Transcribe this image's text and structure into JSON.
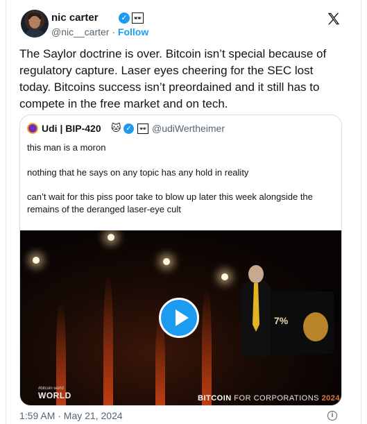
{
  "author": {
    "name": "nic carter",
    "handle": "@nic__carter",
    "separator": "·",
    "follow_label": "Follow",
    "verified_glyph": "✓",
    "affiliate_icon": "badge-icon"
  },
  "tweet": {
    "text": "The Saylor doctrine is over. Bitcoin isn’t special because of regulatory capture. Laser eyes cheering for the SEC lost today. Bitcoins success isn’t preordained and it still has to compete in the free market and on tech."
  },
  "quote": {
    "name": "Udi | BIP-420",
    "cat_emoji": "🐱",
    "verified_glyph": "✓",
    "handle": "@udiWertheimer",
    "lines": [
      "this man is a moron",
      "nothing that he says on any topic has any hold in reality",
      "can’t wait for this piss poor take to blow up later this week alongside the remains of the deranged laser-eye cult"
    ],
    "video": {
      "screen_text": "7%",
      "watermark_left_small": "#bitcoin world",
      "watermark_left": "WORLD",
      "watermark_right_1": "BITCOIN",
      "watermark_right_2": "FOR CORPORATIONS",
      "watermark_right_3": "2024"
    }
  },
  "footer": {
    "timestamp": "1:59 AM · May 21, 2024",
    "info_glyph": "i"
  },
  "colors": {
    "accent": "#1d9bf0",
    "text": "#0f1419",
    "muted": "#536471",
    "border": "#d7dde2"
  }
}
